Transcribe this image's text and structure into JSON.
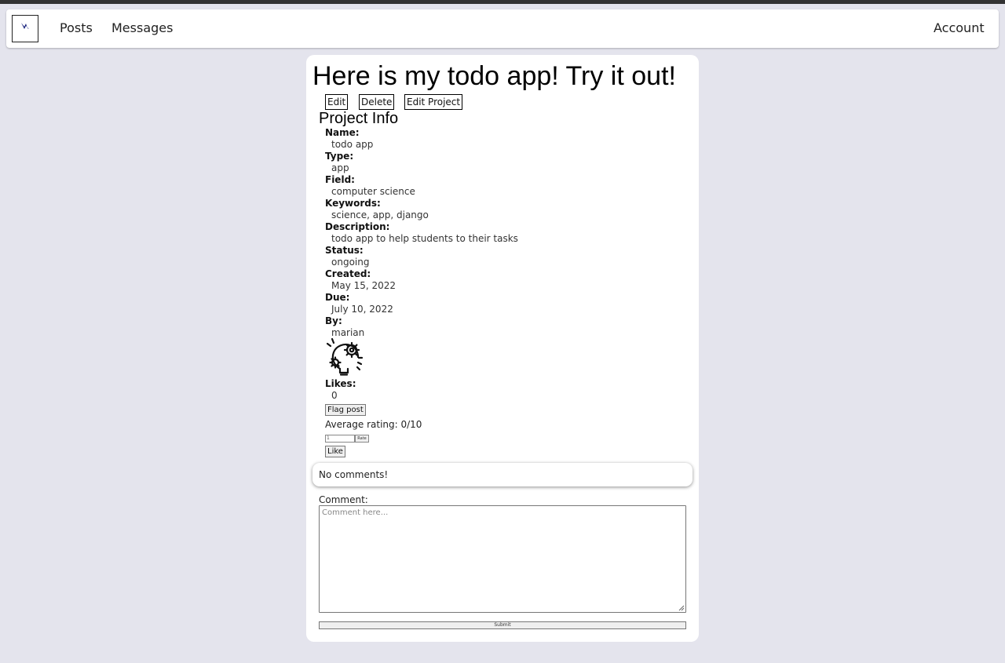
{
  "nav": {
    "links": [
      "Posts",
      "Messages"
    ],
    "account": "Account"
  },
  "post": {
    "title": "Here is my todo app! Try it out!",
    "actions": [
      "Edit",
      "Delete",
      "Edit Project"
    ]
  },
  "project": {
    "heading": "Project Info",
    "fields": [
      {
        "label": "Name:",
        "value": "todo app"
      },
      {
        "label": "Type:",
        "value": "app"
      },
      {
        "label": "Field:",
        "value": "computer science"
      },
      {
        "label": "Keywords:",
        "value": "science, app, django"
      },
      {
        "label": "Description:",
        "value": "todo app to help students to their tasks"
      },
      {
        "label": "Status:",
        "value": "ongoing"
      },
      {
        "label": "Created:",
        "value": "May 15, 2022"
      },
      {
        "label": "Due:",
        "value": "July 10, 2022"
      },
      {
        "label": "By:",
        "value": "marian"
      }
    ],
    "icon": "lightbulb-gear-icon"
  },
  "likes": {
    "label": "Likes:",
    "value": "0"
  },
  "flag_button": "Flag post",
  "rating": {
    "text": "Average rating: 0/10",
    "input_value": "1",
    "rate_button": "Rate"
  },
  "like_button": "Like",
  "comments": {
    "empty_text": "No comments!",
    "label": "Comment:",
    "placeholder": "Comment here...",
    "submit": "Submit"
  },
  "colors": {
    "background": "#e4e4ed",
    "logo_accent": "#1a237e"
  }
}
